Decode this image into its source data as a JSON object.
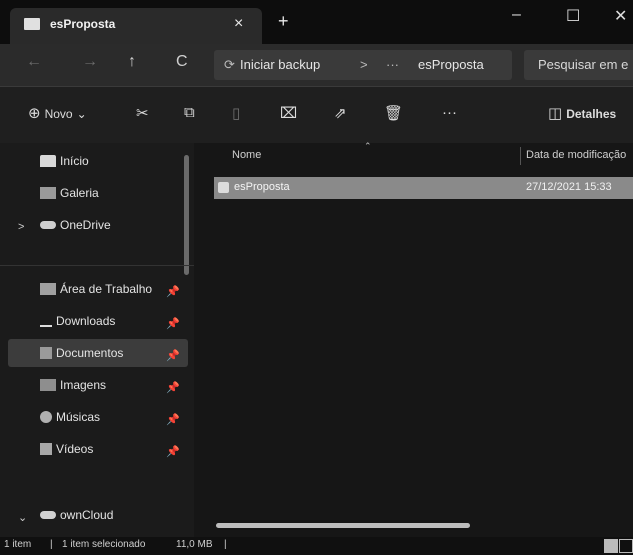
{
  "window": {
    "tab_title": "esProposta",
    "tab_close": "×",
    "new_tab": "+",
    "minimize": "–",
    "maximize": "☐",
    "close": "✕"
  },
  "nav": {
    "back": "←",
    "forward": "→",
    "up": "↑",
    "refresh": "C"
  },
  "address": {
    "backup_icon": "⟳",
    "backup_label": "Iniciar backup",
    "sep1": ">",
    "more": "···",
    "current": "esProposta"
  },
  "search": {
    "placeholder": "Pesquisar em e"
  },
  "toolbar": {
    "new_icon": "⊕",
    "new_label": "Novo",
    "new_chevron": "⌄",
    "cut": "✂",
    "copy": "⧉",
    "paste": "▯",
    "rename": "⌧",
    "share": "⇗",
    "delete": "🗑",
    "more": "···",
    "details_icon": "◫",
    "details_label": "Detalhes"
  },
  "sidebar": {
    "items": [
      {
        "label": "Início",
        "icon": "home-icon"
      },
      {
        "label": "Galeria",
        "icon": "gallery-icon"
      },
      {
        "label": "OneDrive",
        "icon": "cloud-icon",
        "chevron": ">"
      },
      {
        "label": "Área de Trabalho",
        "icon": "desktop-icon",
        "pin": "📌"
      },
      {
        "label": "Downloads",
        "icon": "download-icon",
        "pin": "📌"
      },
      {
        "label": "Documentos",
        "icon": "documents-icon",
        "pin": "📌"
      },
      {
        "label": "Imagens",
        "icon": "pictures-icon",
        "pin": "📌"
      },
      {
        "label": "Músicas",
        "icon": "music-icon",
        "pin": "📌"
      },
      {
        "label": "Vídeos",
        "icon": "videos-icon",
        "pin": "📌"
      },
      {
        "label": "ownCloud",
        "icon": "cloud-icon",
        "chevron": "⌄"
      }
    ]
  },
  "files": {
    "columns": {
      "name": "Nome",
      "date": "Data de modificação"
    },
    "rows": [
      {
        "name": "esProposta",
        "date": "27/12/2021 15:33"
      }
    ]
  },
  "status": {
    "count": "1 item",
    "sep": "|",
    "selected": "1 item selecionado",
    "size": "11,0 MB",
    "sep2": "|"
  },
  "colors": {
    "accent": "#8a8a8a",
    "background": "#1b1b1b"
  }
}
